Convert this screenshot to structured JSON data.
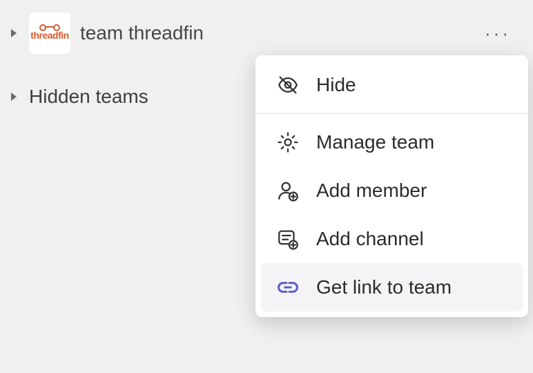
{
  "sidebar": {
    "team": {
      "name": "team threadfin",
      "avatar_text": "threadfin"
    },
    "hidden_label": "Hidden teams",
    "more_glyph": "···"
  },
  "menu": {
    "hide": "Hide",
    "manage": "Manage team",
    "add_member": "Add member",
    "add_channel": "Add channel",
    "get_link": "Get link to team"
  },
  "colors": {
    "link_icon": "#5b5fc7"
  }
}
